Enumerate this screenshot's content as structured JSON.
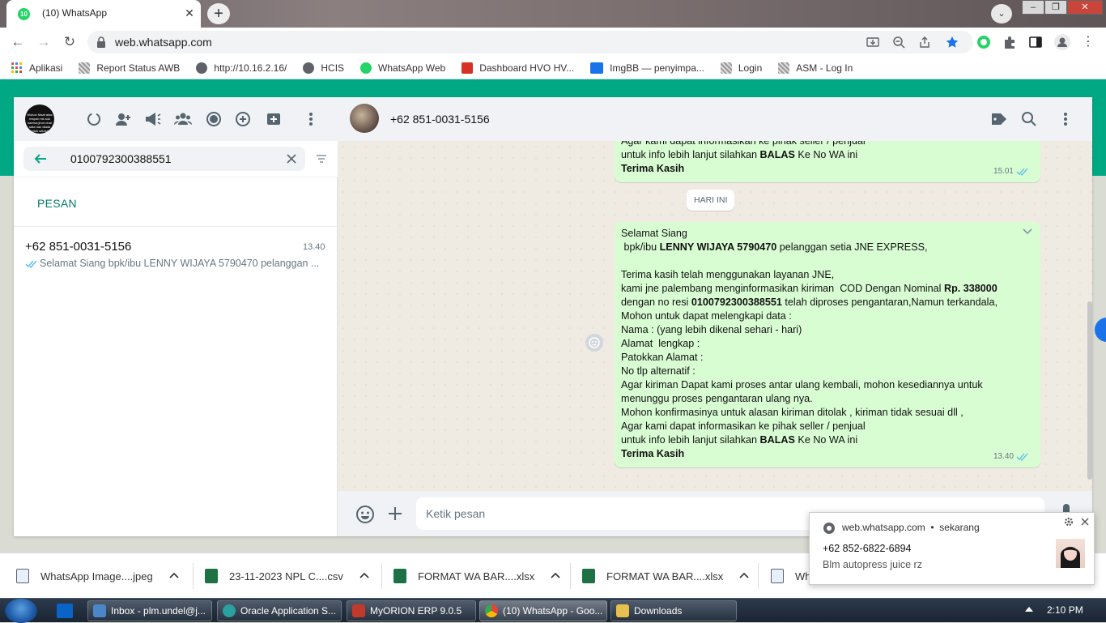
{
  "browser": {
    "tab_title": "(10) WhatsApp",
    "tab_badge": "10",
    "url": "web.whatsapp.com"
  },
  "bookmarks": [
    {
      "label": "Aplikasi",
      "icon": "apps-grid-icon"
    },
    {
      "label": "Report Status AWB",
      "icon": "page-icon"
    },
    {
      "label": "http://10.16.2.16/",
      "icon": "globe-icon"
    },
    {
      "label": "HCIS",
      "icon": "globe-icon"
    },
    {
      "label": "WhatsApp Web",
      "icon": "whatsapp-icon"
    },
    {
      "label": "Dashboard HVO HV...",
      "icon": "dashboard-icon"
    },
    {
      "label": "ImgBB — penyimpa...",
      "icon": "imgbb-icon"
    },
    {
      "label": "Login",
      "icon": "page-icon"
    },
    {
      "label": "ASM - Log In",
      "icon": "page-icon"
    }
  ],
  "sidebar": {
    "avatar_text": "Mohon Maaf atas respon nis suk karena jiron chat sata dan diada untuk selesai",
    "search_value": "0100792300388551",
    "section_label": "PESAN",
    "result": {
      "name": "+62 851-0031-5156",
      "time": "13.40",
      "preview": "Selamat Siang   bpk/ibu LENNY WIJAYA 5790470 pelanggan ..."
    }
  },
  "chat": {
    "contact": "+62 851-0031-5156",
    "day_chip": "HARI INI",
    "compose_placeholder": "Ketik pesan",
    "prev_message": {
      "lines": [
        "Agar kami dapat informasikan ke pihak seller / penjual",
        "untuk info lebih lanjut silahkan |BALAS| Ke No WA ini",
        "|Terima Kasih|"
      ],
      "time": "15.01"
    },
    "message": {
      "lines": [
        "Selamat Siang",
        " bpk/ibu |LENNY WIJAYA 5790470| pelanggan setia JNE EXPRESS,",
        "",
        "Terima kasih telah menggunakan layanan JNE,",
        "kami jne palembang menginformasikan kiriman  COD Dengan Nominal |Rp. 338000|",
        "dengan no resi |0100792300388551| telah diproses pengantaran,Namun terkandala,",
        "Mohon untuk dapat melengkapi data :",
        "Nama : (yang lebih dikenal sehari - hari)",
        "Alamat  lengkap :",
        "Patokkan Alamat :",
        "No tlp alternatif :",
        "Agar kiriman Dapat kami proses antar ulang kembali, mohon kesediannya untuk",
        "menunggu proses pengantaran ulang nya.",
        "Mohon konfirmasinya untuk alasan kiriman ditolak , kiriman tidak sesuai dll ,",
        "Agar kami dapat informasikan ke pihak seller / penjual",
        "untuk info lebih lanjut silahkan |BALAS| Ke No WA ini",
        "|Terima Kasih|"
      ],
      "time": "13.40"
    }
  },
  "notification": {
    "source": "web.whatsapp.com",
    "separator": "•",
    "when": "sekarang",
    "title": "+62 852-6822-6894",
    "body": "Blm autopress juice rz"
  },
  "downloads": [
    {
      "name": "WhatsApp Image....jpeg",
      "kind": "image"
    },
    {
      "name": "23-11-2023 NPL C....csv",
      "kind": "excel"
    },
    {
      "name": "FORMAT WA BAR....xlsx",
      "kind": "excel"
    },
    {
      "name": "FORMAT WA BAR....xlsx",
      "kind": "excel"
    },
    {
      "name": "Wh",
      "kind": "image"
    }
  ],
  "taskbar": {
    "items": [
      {
        "label": "Inbox - plm.undel@j..."
      },
      {
        "label": "Oracle Application S..."
      },
      {
        "label": "MyORION ERP 9.0.5"
      },
      {
        "label": "(10) WhatsApp - Goo..."
      },
      {
        "label": "Downloads"
      }
    ],
    "clock": "2:10 PM"
  },
  "colors": {
    "wa_green": "#00a884",
    "bubble_out": "#d9fdd3",
    "tick_blue": "#53bdeb",
    "link_teal": "#008069"
  }
}
